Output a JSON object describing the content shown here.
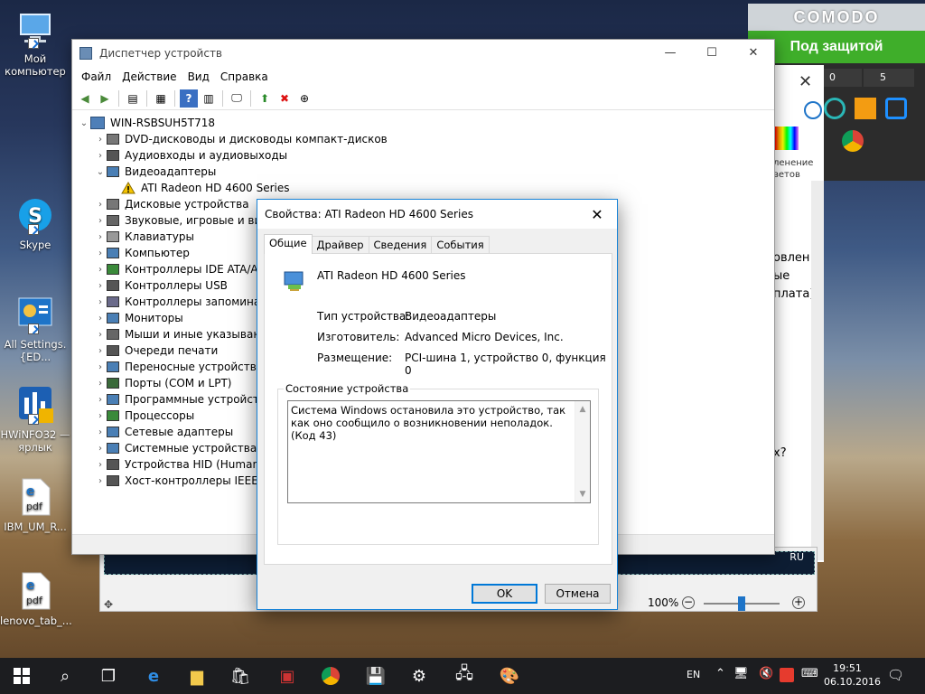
{
  "desktop": {
    "icons": [
      {
        "label": "Мой компьютер"
      },
      {
        "label": "Skype"
      },
      {
        "label": "All Settings.{ED..."
      },
      {
        "label": "HWiNFO32 — ярлык"
      },
      {
        "label": "IBM_UM_R..."
      },
      {
        "label": "lenovo_tab_..."
      }
    ]
  },
  "comodo": {
    "brand": "COMODO",
    "status": "Под защитой",
    "counter_left": "0",
    "counter_right": "5"
  },
  "background_window": {
    "text_lines": [
      "овлен",
      "ые",
      "плата)"
    ],
    "question": "х?",
    "lang": "RU",
    "color_caption": "ленение\nветов"
  },
  "word": {
    "zoom": "100%"
  },
  "device_manager": {
    "title": "Диспетчер устройств",
    "menu": [
      "Файл",
      "Действие",
      "Вид",
      "Справка"
    ],
    "root": "WIN-RSBSUH5T718",
    "tree": [
      {
        "label": "DVD-дисководы и дисководы компакт-дисков",
        "expanded": false
      },
      {
        "label": "Аудиовходы и аудиовыходы",
        "expanded": false
      },
      {
        "label": "Видеоадаптеры",
        "expanded": true
      },
      {
        "label": "ATI Radeon HD 4600 Series",
        "child": true,
        "warning": true
      },
      {
        "label": "Дисковые устройства",
        "expanded": false
      },
      {
        "label": "Звуковые, игровые и виде",
        "expanded": false
      },
      {
        "label": "Клавиатуры",
        "expanded": false
      },
      {
        "label": "Компьютер",
        "expanded": false
      },
      {
        "label": "Контроллеры IDE ATA/ATA",
        "expanded": false
      },
      {
        "label": "Контроллеры USB",
        "expanded": false
      },
      {
        "label": "Контроллеры запоминаю",
        "expanded": false
      },
      {
        "label": "Мониторы",
        "expanded": false
      },
      {
        "label": "Мыши и иные указываю",
        "expanded": false
      },
      {
        "label": "Очереди печати",
        "expanded": false
      },
      {
        "label": "Переносные устройства",
        "expanded": false
      },
      {
        "label": "Порты (COM и LPT)",
        "expanded": false
      },
      {
        "label": "Программные устройства",
        "expanded": false
      },
      {
        "label": "Процессоры",
        "expanded": false
      },
      {
        "label": "Сетевые адаптеры",
        "expanded": false
      },
      {
        "label": "Системные устройства",
        "expanded": false
      },
      {
        "label": "Устройства HID (Human In",
        "expanded": false
      },
      {
        "label": "Хост-контроллеры IEEE 13",
        "expanded": false
      }
    ]
  },
  "dialog": {
    "title": "Свойства: ATI Radeon HD 4600 Series",
    "tabs": [
      "Общие",
      "Драйвер",
      "Сведения",
      "События"
    ],
    "device_name": "ATI Radeon HD 4600 Series",
    "props": [
      {
        "label": "Тип устройства:",
        "value": "Видеоадаптеры"
      },
      {
        "label": "Изготовитель:",
        "value": "Advanced Micro Devices, Inc."
      },
      {
        "label": "Размещение:",
        "value": "PCI-шина 1, устройство 0, функция 0"
      }
    ],
    "status_group": "Состояние устройства",
    "status_text": "Система Windows остановила это устройство, так как оно сообщило о возникновении неполадок. (Код 43)",
    "ok": "OK",
    "cancel": "Отмена"
  },
  "taskbar": {
    "lang": "EN",
    "time": "19:51",
    "date": "06.10.2016"
  },
  "colors": {
    "accent": "#0078d7",
    "comodo_green": "#3fae2a",
    "taskbar": "#1c1d20"
  }
}
